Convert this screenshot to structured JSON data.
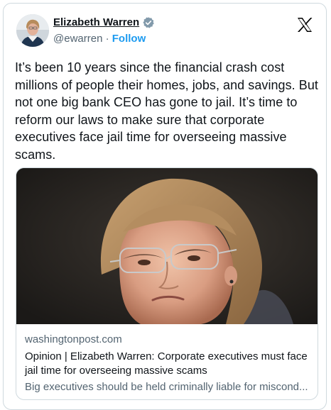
{
  "tweet": {
    "author_name": "Elizabeth Warren",
    "handle": "@ewarren",
    "separator": "·",
    "follow_label": "Follow",
    "text": "It’s been 10 years since the financial crash cost millions of people their homes, jobs, and savings. But not one big bank CEO has gone to jail. It’s time to reform our laws to make sure that corporate executives face jail time for overseeing massive scams."
  },
  "link_card": {
    "domain": "washingtonpost.com",
    "title": "Opinion | Elizabeth Warren: Corporate executives must face jail time for overseeing massive scams",
    "description": "Big executives should be held criminally liable for miscond..."
  },
  "icons": {
    "verified": "verified-badge-icon",
    "brand": "x-logo-icon"
  },
  "colors": {
    "text": "#0f1419",
    "secondary": "#536471",
    "accent": "#1d9bf0",
    "border": "#cfd9de"
  }
}
